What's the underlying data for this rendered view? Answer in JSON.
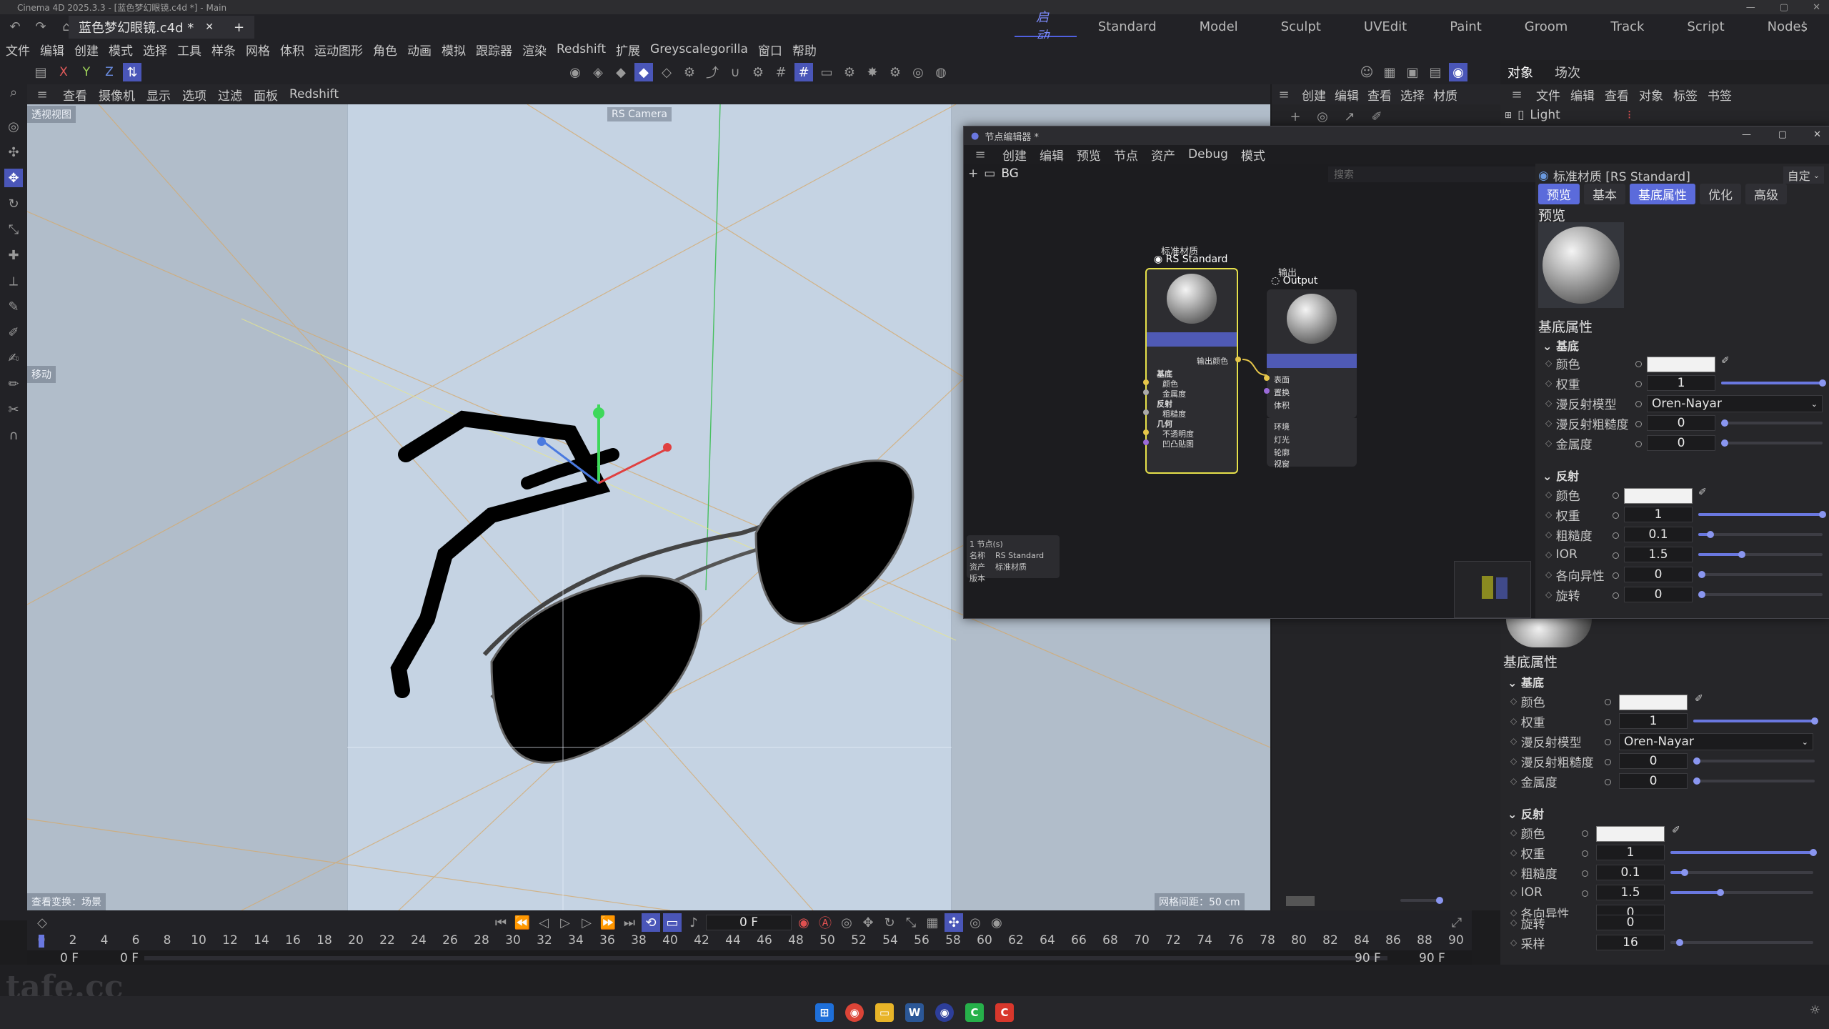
{
  "app": {
    "window_title": "Cinema 4D 2025.3.3 - [蓝色梦幻眼镜.c4d *] - Main",
    "doc_tab": "蓝色梦幻眼镜.c4d *",
    "layouts": [
      "启动",
      "Standard",
      "Model",
      "Sculpt",
      "UVEdit",
      "Paint",
      "Groom",
      "Track",
      "Script",
      "Nodes"
    ],
    "active_layout": "启动"
  },
  "menubar": [
    "文件",
    "编辑",
    "创建",
    "模式",
    "选择",
    "工具",
    "样条",
    "网格",
    "体积",
    "运动图形",
    "角色",
    "动画",
    "模拟",
    "跟踪器",
    "渲染",
    "Redshift",
    "扩展",
    "Greyscalegorilla",
    "窗口",
    "帮助"
  ],
  "axis_buttons": [
    "X",
    "Y",
    "Z"
  ],
  "viewport": {
    "menu": [
      "查看",
      "摄像机",
      "显示",
      "选项",
      "过滤",
      "面板",
      "Redshift"
    ],
    "view_name": "透视视图",
    "camera_label": "RS Camera",
    "move_label": "移动",
    "bottom_left": "查看变换：场景",
    "bottom_right": "网格间距：50 cm"
  },
  "objects_panel": {
    "tabs": [
      "对象",
      "场次"
    ],
    "menu": [
      "文件",
      "编辑",
      "查看",
      "对象",
      "标签",
      "书签"
    ],
    "items": [
      {
        "name": "Light"
      }
    ],
    "material_menu": [
      "创建",
      "编辑",
      "查看",
      "选择",
      "材质"
    ]
  },
  "node_editor": {
    "title": "节点编辑器 *",
    "menu": [
      "创建",
      "编辑",
      "预览",
      "节点",
      "资产",
      "Debug",
      "模式"
    ],
    "breadcrumb": "BG",
    "search_placeholder": "搜索",
    "node1": {
      "title_cn": "标准材质",
      "title": "RS Standard",
      "out": "输出颜色",
      "groups": [
        "基底",
        "颜色",
        "金属度",
        "反射",
        "粗糙度",
        "几何",
        "不透明度",
        "凹凸贴图"
      ]
    },
    "node2": {
      "title_cn": "输出",
      "title": "Output",
      "inputs": [
        "表面",
        "置换",
        "体积",
        "环境",
        "灯光",
        "轮廓",
        "视窗"
      ]
    },
    "info": {
      "count": "1 节点(s)",
      "name_label": "名称",
      "name_value": "RS Standard",
      "asset_label": "资产",
      "asset_value": "标准材质",
      "version_label": "版本"
    }
  },
  "material_attrs": {
    "header": "标准材质 [RS Standard]",
    "custom": "自定",
    "tabs": [
      "预览",
      "基本",
      "基底属性",
      "优化",
      "高级"
    ],
    "active_tabs": [
      "预览",
      "基底属性"
    ],
    "preview_label": "预览",
    "section": "基底属性",
    "base": {
      "title": "基底",
      "color": "颜色",
      "weight_label": "权重",
      "weight": "1",
      "diffuse_model_label": "漫反射模型",
      "diffuse_model": "Oren-Nayar",
      "diffuse_rough_label": "漫反射粗糙度",
      "diffuse_rough": "0",
      "metal_label": "金属度",
      "metal": "0"
    },
    "reflection": {
      "title": "反射",
      "color": "颜色",
      "weight_label": "权重",
      "weight": "1",
      "rough_label": "粗糙度",
      "rough": "0.1",
      "ior_label": "IOR",
      "ior": "1.5",
      "aniso_label": "各向异性",
      "aniso": "0",
      "rot_label": "旋转",
      "rot": "0",
      "samples_label": "采样",
      "samples": "16"
    },
    "weight_level": 1.0,
    "rough_level": 0.1,
    "ior_level": 0.35
  },
  "timeline": {
    "current_frame": "0 F",
    "start": "0 F",
    "start2": "0 F",
    "end": "90 F",
    "end2": "90 F",
    "ticks": [
      "0",
      "2",
      "4",
      "6",
      "8",
      "10",
      "12",
      "14",
      "16",
      "18",
      "20",
      "22",
      "24",
      "26",
      "28",
      "30",
      "32",
      "34",
      "36",
      "38",
      "40",
      "42",
      "44",
      "46",
      "48",
      "50",
      "52",
      "54",
      "56",
      "58",
      "60",
      "62",
      "64",
      "66",
      "68",
      "70",
      "72",
      "74",
      "76",
      "78",
      "80",
      "82",
      "84",
      "86",
      "88",
      "90"
    ]
  },
  "watermark": "tafe.cc",
  "colors": {
    "accent": "#5b6bdb",
    "selection": "#e6e04a",
    "node_header": "#4f5ab5"
  }
}
